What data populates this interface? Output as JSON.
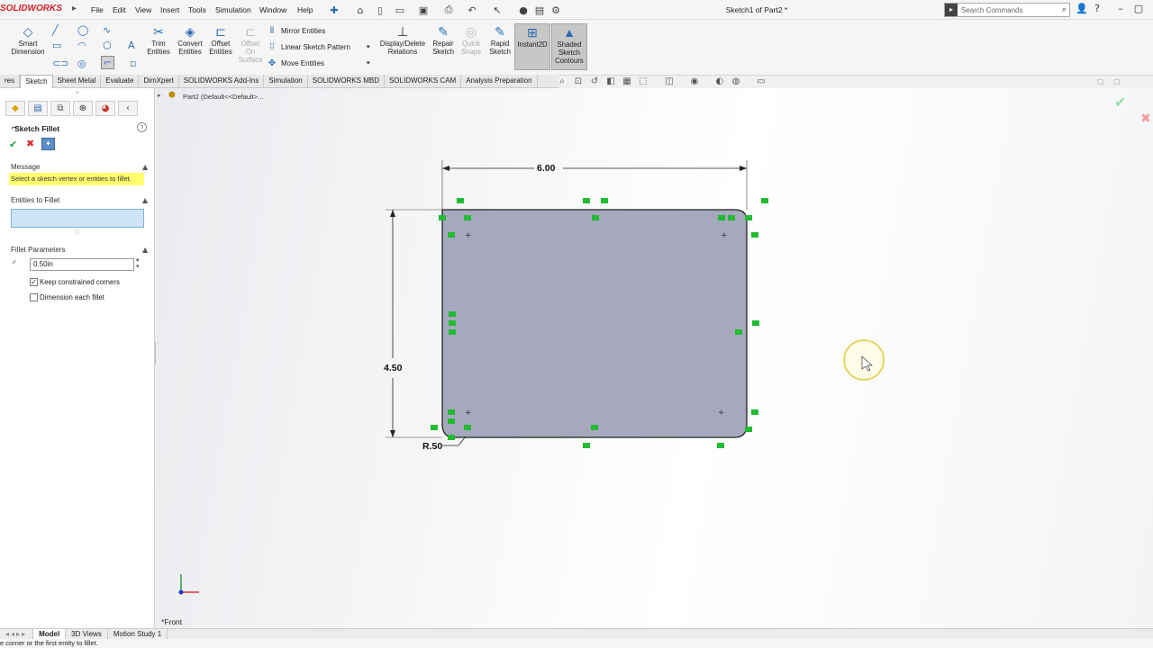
{
  "app": {
    "logo_text": "SOLIDWORKS",
    "document_title": "Sketch1 of Part2 *"
  },
  "menu": [
    "File",
    "Edit",
    "View",
    "Insert",
    "Tools",
    "Simulation",
    "Window",
    "Help"
  ],
  "search": {
    "placeholder": "Search Commands"
  },
  "toolbar": {
    "smart_dimension": "Smart Dimension",
    "trim_entities": "Trim Entities",
    "convert_entities": "Convert Entities",
    "offset_entities": "Offset Entities",
    "offset_on_surface": "Offset On Surface",
    "mirror_entities": "Mirror Entities",
    "linear_sketch_pattern": "Linear Sketch Pattern",
    "move_entities": "Move Entities",
    "display_delete_relations": "Display/Delete Relations",
    "repair_sketch": "Repair Sketch",
    "quick_snaps": "Quick Snaps",
    "rapid_sketch": "Rapid Sketch",
    "instant2d": "Instant2D",
    "shaded_sketch_contours": "Shaded Sketch Contours"
  },
  "tabs": [
    {
      "label": "res"
    },
    {
      "label": "Sketch"
    },
    {
      "label": "Sheet Metal"
    },
    {
      "label": "Evaluate"
    },
    {
      "label": "DimXpert"
    },
    {
      "label": "SOLIDWORKS Add-Ins"
    },
    {
      "label": "Simulation"
    },
    {
      "label": "SOLIDWORKS MBD"
    },
    {
      "label": "SOLIDWORKS CAM"
    },
    {
      "label": "Analysis Preparation"
    }
  ],
  "property_manager": {
    "title": "Sketch Fillet",
    "message_header": "Message",
    "message": "Select a sketch vertex or entities to fillet.",
    "entities_header": "Entities to Fillet",
    "params_header": "Fillet Parameters",
    "radius_value": "0.50in",
    "keep_constrained_label": "Keep constrained corners",
    "keep_constrained_checked": true,
    "dimension_each_label": "Dimension each fillet",
    "dimension_each_checked": false
  },
  "canvas": {
    "breadcrumb": "Part2  (Default<<Default>...",
    "dim_width": "6.00",
    "dim_height": "4.50",
    "dim_radius": "R.50",
    "view_name": "*Front",
    "sketch_fill": "#a6a9bd",
    "relation_color": "#22bb33"
  },
  "bottom_tabs": [
    {
      "label": "Model"
    },
    {
      "label": "3D Views"
    },
    {
      "label": "Motion Study 1"
    }
  ],
  "status_text": "e corner or the first entity to fillet."
}
